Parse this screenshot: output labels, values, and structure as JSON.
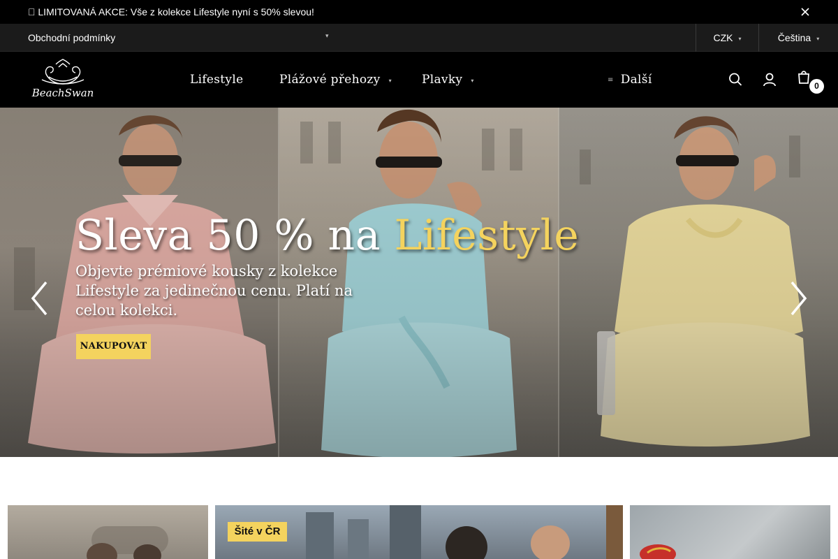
{
  "promo": {
    "text": " LIMITOVANÁ AKCE: Vše z kolekce Lifestyle nyní s 50% slevou!"
  },
  "utility": {
    "terms_link": "Obchodní podmínky",
    "currency": "CZK",
    "language": "Čeština"
  },
  "header": {
    "logo_text": "BeachSwan",
    "nav": {
      "lifestyle": "Lifestyle",
      "prehozy": "Plážové přehozy",
      "plavky": "Plavky",
      "more": "Další"
    },
    "cart_count": "0"
  },
  "hero": {
    "title_lead": "Sleva 50 % na ",
    "title_accent": "Lifestyle",
    "subtitle": "Objevte prémiové kousky z kolekce Lifestyle za jedinečnou cenu. Platí na celou kolekci.",
    "cta": "NAKUPOVAT"
  },
  "tiles": [
    {
      "badge": ""
    },
    {
      "badge": "Šité v ČR"
    },
    {
      "badge": ""
    }
  ],
  "colors": {
    "accent": "#f4d35e",
    "header_bg": "#000000",
    "utility_bg": "#1b1b1b"
  },
  "icons": {
    "close": "close-icon",
    "search": "search-icon",
    "user": "user-icon",
    "cart": "cart-icon",
    "prev": "chevron-left-icon",
    "next": "chevron-right-icon"
  }
}
